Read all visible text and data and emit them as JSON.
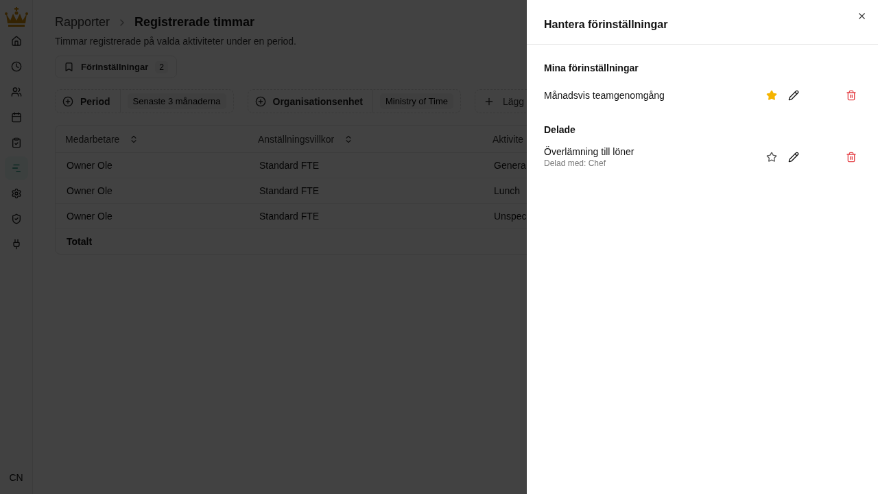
{
  "sidebar": {
    "items": [
      {
        "selected": false
      },
      {
        "selected": false
      },
      {
        "selected": false
      },
      {
        "selected": false
      },
      {
        "selected": false
      },
      {
        "selected": true
      },
      {
        "selected": false
      },
      {
        "selected": false
      },
      {
        "selected": false
      }
    ],
    "user_initials": "CN"
  },
  "breadcrumb": {
    "parent": "Rapporter",
    "current": "Registrerade timmar"
  },
  "subtitle": "Timmar registrerade på valda aktiviteter under en period.",
  "presets_button": {
    "label": "Förinställningar",
    "count": "2"
  },
  "filters": [
    {
      "kind": "filter",
      "label": "Period",
      "value": "Senaste 3 månaderna"
    },
    {
      "kind": "filter",
      "label": "Organisationsenhet",
      "value": "Ministry of Time"
    },
    {
      "kind": "add",
      "label": "Lägg"
    }
  ],
  "table": {
    "columns": [
      {
        "label": "Medarbetare",
        "sortable": true
      },
      {
        "label": "Anställningsvillkor",
        "sortable": true
      },
      {
        "label": "Aktivite"
      }
    ],
    "rows": [
      [
        "Owner Ole",
        "Standard FTE",
        "Genera"
      ],
      [
        "Owner Ole",
        "Standard FTE",
        "Lunch"
      ],
      [
        "Owner Ole",
        "Standard FTE",
        "Unspec"
      ]
    ],
    "total_label": "Totalt"
  },
  "drawer": {
    "title": "Hantera förinställningar",
    "sections": [
      {
        "title": "Mina förinställningar",
        "items": [
          {
            "name": "Månadsvis teamgenomgång",
            "favorite": true
          }
        ]
      },
      {
        "title": "Delade",
        "items": [
          {
            "name": "Överlämning till löner",
            "shared_with": "Delad med: Chef",
            "favorite": false
          }
        ]
      }
    ]
  }
}
